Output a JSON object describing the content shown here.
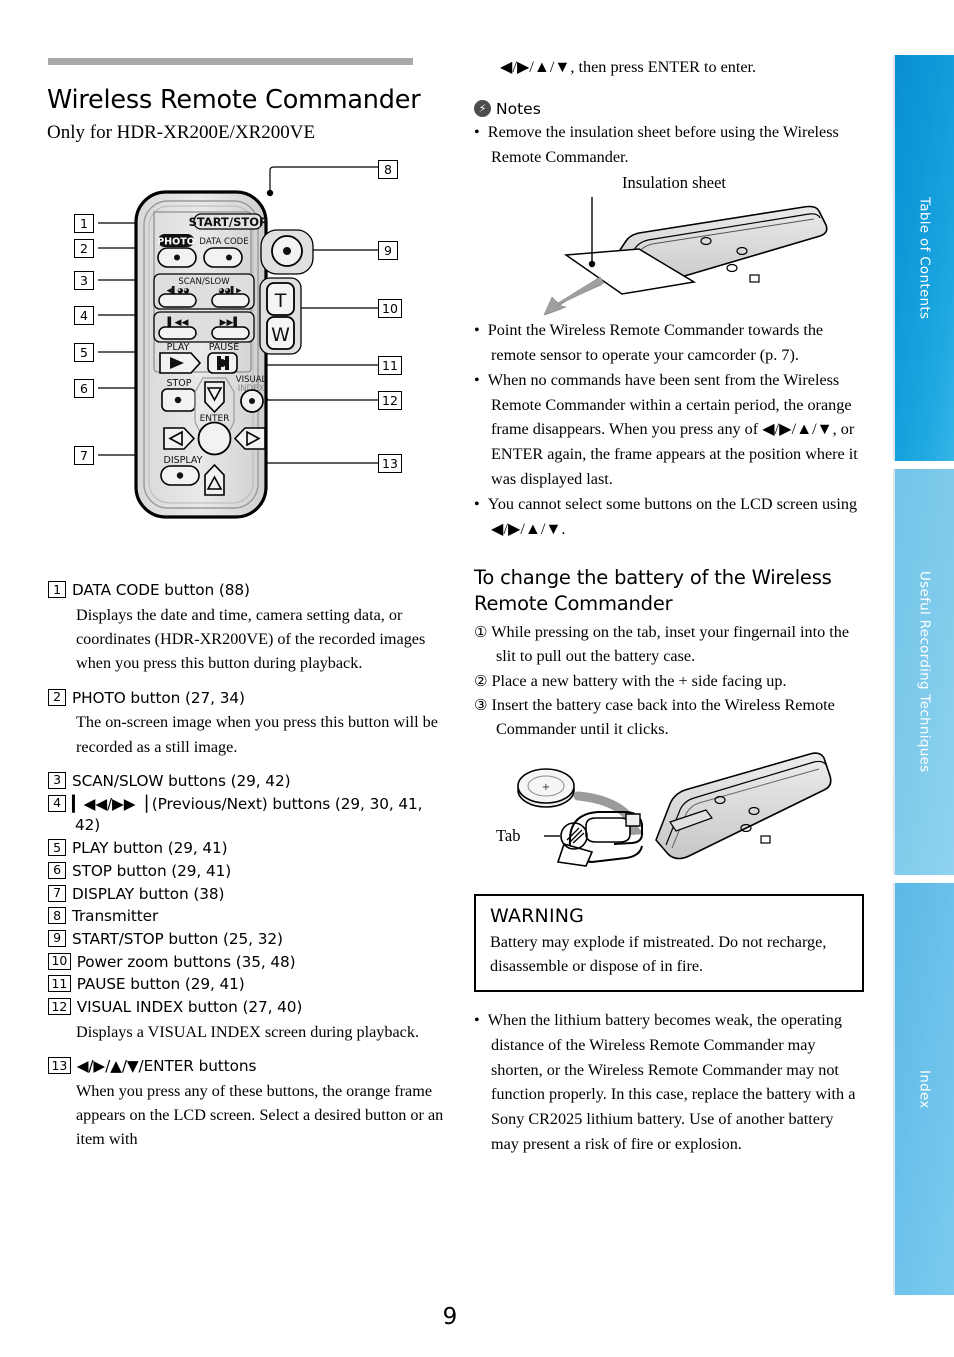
{
  "document": {
    "page_number": "9",
    "title": "Wireless Remote Commander",
    "subtitle": "Only for HDR-XR200E/XR200VE"
  },
  "side_tabs": [
    {
      "label": "Table of Contents",
      "active": true
    },
    {
      "label": "Useful Recording Techniques",
      "active": false
    },
    {
      "label": "Index",
      "active": false
    }
  ],
  "remote_figure": {
    "name": "wireless-remote-commander-diagram",
    "button_labels": {
      "start_stop": "START/STOP",
      "photo": "PHOTO",
      "data_code": "DATA CODE",
      "scan_slow": "SCAN/SLOW",
      "play": "PLAY",
      "pause": "PAUSE",
      "stop": "STOP",
      "display": "DISPLAY",
      "visual": "VISUAL",
      "index": "INDEX",
      "enter": "ENTER",
      "zoom_t": "T",
      "zoom_w": "W",
      "prev": "▎◀◀",
      "next": "▶▶▕"
    },
    "callouts": [
      "1",
      "2",
      "3",
      "4",
      "5",
      "6",
      "7",
      "8",
      "9",
      "10",
      "11",
      "12",
      "13"
    ]
  },
  "left_column": {
    "entries": [
      {
        "num": "1",
        "title": "DATA CODE button (88)",
        "body": "Displays the date and time, camera setting data, or coordinates (HDR-XR200VE) of the recorded images when you press this button during playback."
      },
      {
        "num": "2",
        "title": "PHOTO button (27, 34)",
        "body": "The on-screen image when you press this button will be recorded as a still image."
      },
      {
        "num": "3",
        "title": "SCAN/SLOW buttons (29, 42)",
        "body": ""
      },
      {
        "num": "4",
        "title": "▎◀◀/▶▶▕ (Previous/Next) buttons (29, 30, 41, 42)",
        "body": ""
      },
      {
        "num": "5",
        "title": "PLAY button (29, 41)",
        "body": ""
      },
      {
        "num": "6",
        "title": "STOP button (29, 41)",
        "body": ""
      },
      {
        "num": "7",
        "title": "DISPLAY button (38)",
        "body": ""
      },
      {
        "num": "8",
        "title": "Transmitter",
        "body": ""
      },
      {
        "num": "9",
        "title": "START/STOP button (25, 32)",
        "body": ""
      },
      {
        "num": "10",
        "title": "Power zoom buttons (35, 48)",
        "body": ""
      },
      {
        "num": "11",
        "title": "PAUSE button (29, 41)",
        "body": ""
      },
      {
        "num": "12",
        "title": "VISUAL INDEX button (27, 40)",
        "body": "Displays a VISUAL INDEX screen during playback."
      },
      {
        "num": "13",
        "title": "◀/▶/▲/▼/ENTER buttons",
        "body": "When you press any of these buttons, the orange frame appears on the LCD screen. Select a desired button or an item with"
      }
    ]
  },
  "right_column": {
    "continuation": "◀/▶/▲/▼, then press ENTER to enter.",
    "notes_heading": "Notes",
    "notes": [
      "Remove the insulation sheet before using the Wireless Remote Commander."
    ],
    "insulation_figure_label": "Insulation sheet",
    "notes2": [
      "Point the Wireless Remote Commander towards the remote sensor to operate your camcorder (p. 7).",
      "When no commands have been sent from the Wireless Remote Commander within a certain period, the orange frame disappears. When you press any of ◀/▶/▲/▼, or ENTER again, the frame appears at the position where it was displayed last.",
      "You cannot select some buttons on the LCD screen using ◀/▶/▲/▼."
    ],
    "battery_heading": "To change the battery of the Wireless Remote Commander",
    "battery_steps": [
      {
        "marker": "①",
        "text": "While pressing on the tab, inset your fingernail into the slit to pull out the battery case."
      },
      {
        "marker": "②",
        "text": "Place a new battery with the + side facing up."
      },
      {
        "marker": "③",
        "text": "Insert the battery case back into the Wireless Remote Commander until it clicks."
      }
    ],
    "battery_figure_label": "Tab",
    "warning": {
      "title": "WARNING",
      "body": "Battery may explode if mistreated. Do not recharge, disassemble or dispose of in fire."
    },
    "final_notes": [
      "When the lithium battery becomes weak, the operating distance of the Wireless Remote Commander may shorten, or the Wireless Remote Commander may not function properly. In this case, replace the battery with a Sony CR2025 lithium battery. Use of another battery may present a risk of fire or explosion."
    ]
  },
  "colors": {
    "rule": "#a9a9ac",
    "tab_active": "#0e9ad9",
    "tab_inactive": "#7cc9eb",
    "text": "#000000"
  }
}
